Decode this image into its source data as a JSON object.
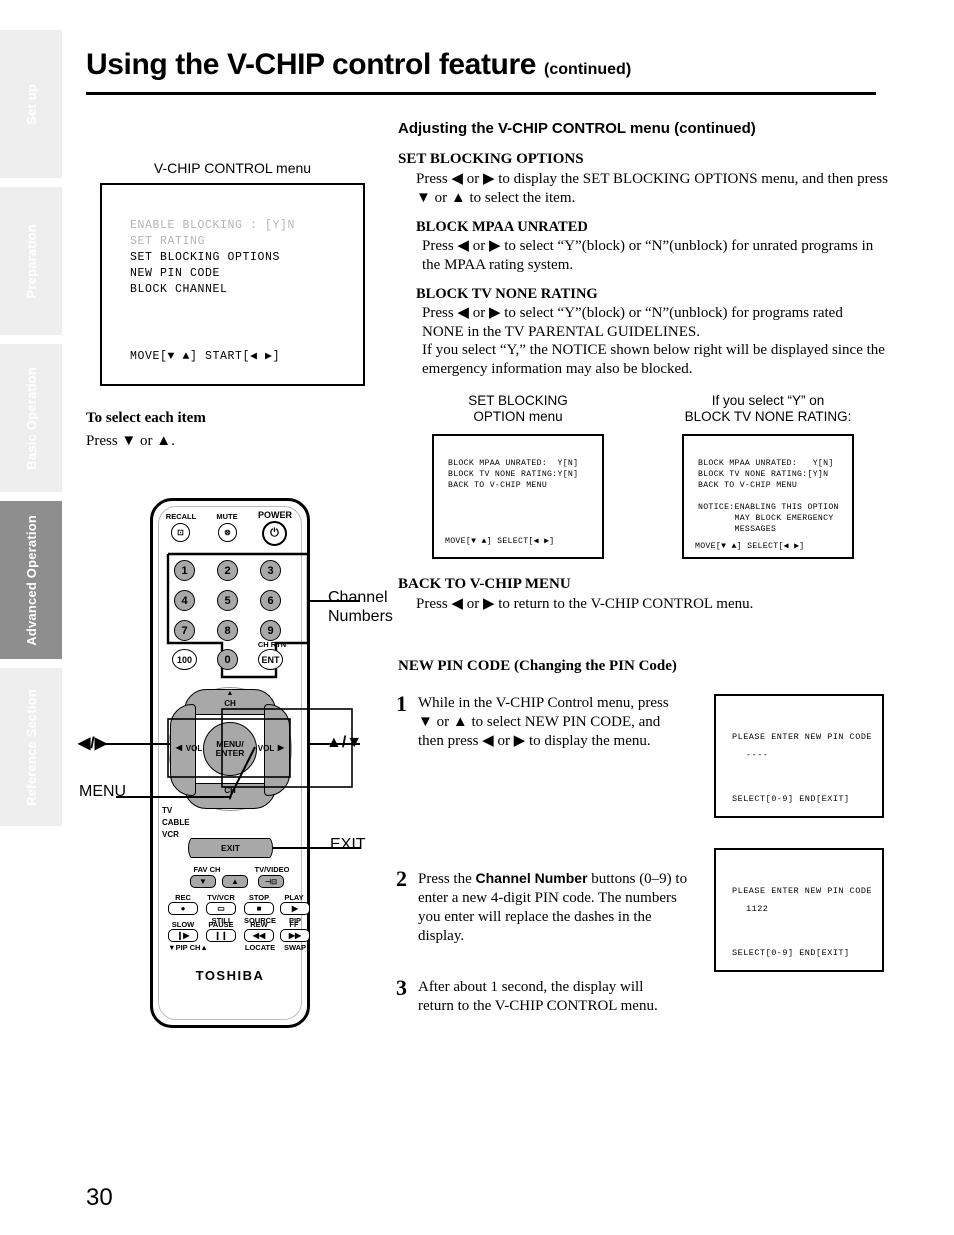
{
  "sidebar": {
    "tabs": [
      {
        "label": "Set up",
        "active": false
      },
      {
        "label": "Preparation",
        "active": false
      },
      {
        "label": "Basic Operation",
        "active": false
      },
      {
        "label": "Advanced Operation",
        "active": true
      },
      {
        "label": "Reference Section",
        "active": false
      }
    ]
  },
  "header": {
    "title": "Using the V-CHIP control feature",
    "continued": "(continued)"
  },
  "left": {
    "menu_caption": "V-CHIP CONTROL menu",
    "menu_lines": [
      {
        "text": "ENABLE BLOCKING : [Y]N",
        "dim": true
      },
      {
        "text": "SET RATING",
        "dim": true
      },
      {
        "text": "SET BLOCKING OPTIONS",
        "dim": false
      },
      {
        "text": "NEW PIN CODE",
        "dim": false
      },
      {
        "text": "BLOCK CHANNEL",
        "dim": false
      }
    ],
    "menu_footer": "MOVE[▼ ▲] START[◀ ▶]",
    "select_item_head": "To select each item",
    "select_item_body": "Press ▼ or ▲."
  },
  "remote": {
    "brand": "TOSHIBA",
    "top_keys": [
      {
        "label": "RECALL",
        "glyph": "⊡"
      },
      {
        "label": "MUTE",
        "glyph": "⊗"
      },
      {
        "label": "POWER",
        "glyph": "⏻"
      }
    ],
    "number_keys": [
      "1",
      "2",
      "3",
      "4",
      "5",
      "6",
      "7",
      "8",
      "9"
    ],
    "hundred_key": "100",
    "zero_key": "0",
    "ent_key": "ENT",
    "ent_label": "CH RTN",
    "dpad": {
      "center": [
        "MENU/",
        "ENTER"
      ],
      "up_label": "CH",
      "down_label": "CH",
      "left_label": "VOL",
      "right_label": "VOL"
    },
    "mode_labels": [
      "TV",
      "CABLE",
      "VCR"
    ],
    "exit_key": "EXIT",
    "fav_row": [
      {
        "above": "FAV CH",
        "glyph": "▼"
      },
      {
        "above": "",
        "glyph": "▲"
      },
      {
        "above": "TV/VIDEO",
        "glyph": "⊣⊡"
      }
    ],
    "deck_row_1": [
      {
        "above": "REC",
        "glyph": "●",
        "below": ""
      },
      {
        "above": "TV/VCR",
        "glyph": "▭",
        "below": "STILL"
      },
      {
        "above": "STOP",
        "glyph": "■",
        "below": "SOURCE"
      },
      {
        "above": "PLAY",
        "glyph": "▶",
        "below": "PIP"
      }
    ],
    "deck_row_2": [
      {
        "above": "SLOW",
        "glyph": "❙▶",
        "below": "▼PIP CH▲"
      },
      {
        "above": "PAUSE",
        "glyph": "❙❙",
        "below": ""
      },
      {
        "above": "REW",
        "glyph": "◀◀",
        "below": "LOCATE"
      },
      {
        "above": "FF",
        "glyph": "▶▶",
        "below": "SWAP"
      }
    ],
    "callouts": {
      "channel_numbers": "Channel\nNumbers",
      "left_right": "◀/▶",
      "up_down": "▲/▼",
      "menu": "MENU",
      "exit": "EXIT"
    }
  },
  "right": {
    "adjusting_heading": "Adjusting the V-CHIP CONTROL menu (continued)",
    "sections": [
      {
        "head": "SET BLOCKING OPTIONS",
        "body": "Press ◀ or ▶  to display the SET BLOCKING OPTIONS menu, and then press ▼ or ▲  to select the item."
      }
    ],
    "sub_sections": [
      {
        "head": "BLOCK MPAA UNRATED",
        "body": "Press ◀ or ▶  to select “Y”(block) or “N”(unblock) for unrated programs in the MPAA rating system."
      },
      {
        "head": "BLOCK TV NONE RATING",
        "body": "Press ◀ or ▶  to select “Y”(block) or “N”(unblock) for programs rated NONE in the TV PARENTAL GUIDELINES.\nIf you select “Y,” the NOTICE shown below right will be displayed since the emergency information may also be blocked."
      }
    ],
    "back_section": {
      "head": "BACK TO V-CHIP MENU",
      "body": "Press ◀ or ▶  to return to the V-CHIP CONTROL menu."
    },
    "pin_heading": "NEW PIN CODE (Changing the PIN Code)",
    "steps": [
      {
        "num": "1",
        "text": "While in the V-CHIP Control menu, press ▼ or ▲ to select NEW PIN CODE, and then press ◀ or ▶  to display the menu."
      },
      {
        "num": "2",
        "text_pre": "Press the ",
        "text_bold": "Channel Number",
        "text_post": " buttons (0–9) to enter a new 4-digit  PIN code. The numbers you enter will replace the dashes in the display."
      },
      {
        "num": "3",
        "text": "After about 1 second, the display will return to the V-CHIP CONTROL menu."
      }
    ],
    "osd_blocking": {
      "caption_line1": "SET BLOCKING",
      "caption_line2": "OPTION menu",
      "lines": [
        "BLOCK MPAA UNRATED:  Y[N]",
        "BLOCK TV NONE RATING:Y[N]",
        "BACK TO V-CHIP MENU"
      ],
      "footer": "MOVE[▼ ▲] SELECT[◀ ▶]"
    },
    "osd_notice": {
      "caption_line1": "If you select “Y” on",
      "caption_line2": "BLOCK TV NONE RATING:",
      "lines": [
        "BLOCK MPAA UNRATED:   Y[N]",
        "BLOCK TV NONE RATING:[Y]N",
        "BACK TO V-CHIP MENU"
      ],
      "notice": [
        "NOTICE:ENABLING THIS OPTION",
        "       MAY BLOCK EMERGENCY",
        "       MESSAGES"
      ],
      "footer": "MOVE[▼ ▲] SELECT[◀ ▶]"
    },
    "pin_box_empty": {
      "prompt": "PLEASE ENTER NEW PIN CODE",
      "value": "----",
      "footer": "SELECT[0-9] END[EXIT]"
    },
    "pin_box_filled": {
      "prompt": "PLEASE ENTER NEW PIN CODE",
      "value": "1122",
      "footer": "SELECT[0-9] END[EXIT]"
    }
  },
  "footer": {
    "page_number": "30"
  }
}
